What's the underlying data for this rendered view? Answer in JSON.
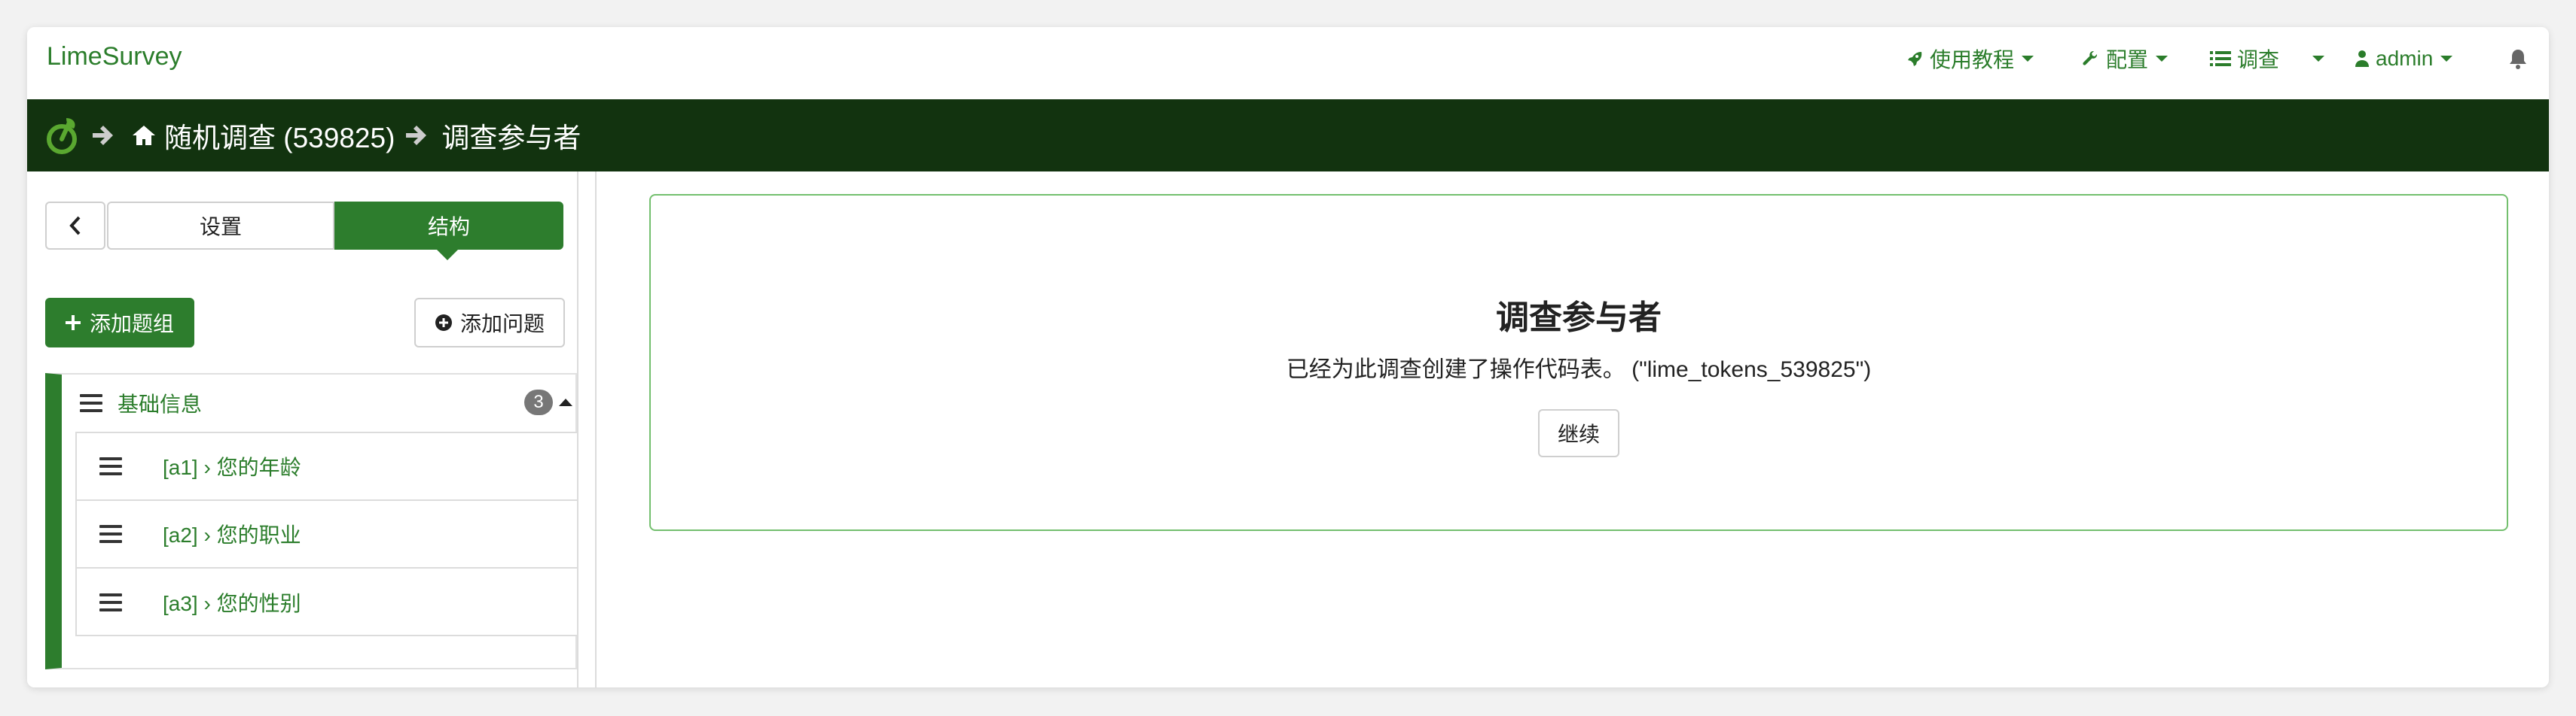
{
  "app": {
    "brand": "LimeSurvey"
  },
  "topnav": {
    "tutorials": "使用教程",
    "config": "配置",
    "surveys": "调查",
    "user": "admin"
  },
  "breadcrumb": {
    "survey": "随机调查 (539825)",
    "page": "调查参与者"
  },
  "sidebar": {
    "tabs": {
      "settings": "设置",
      "structure": "结构"
    },
    "add_group": "添加题组",
    "add_question": "添加问题",
    "group": {
      "title": "基础信息",
      "count": "3",
      "questions": [
        {
          "label": "[a1] › 您的年龄"
        },
        {
          "label": "[a2] › 您的职业"
        },
        {
          "label": "[a3] › 您的性别"
        }
      ]
    }
  },
  "main": {
    "title": "调查参与者",
    "message": "已经为此调查创建了操作代码表。 (\"lime_tokens_539825\")",
    "continue": "继续"
  },
  "colors": {
    "accent": "#2d7d2d",
    "link": "#2b7d2b",
    "crumb_bg": "#12330f",
    "card_border": "#73bf6e"
  }
}
